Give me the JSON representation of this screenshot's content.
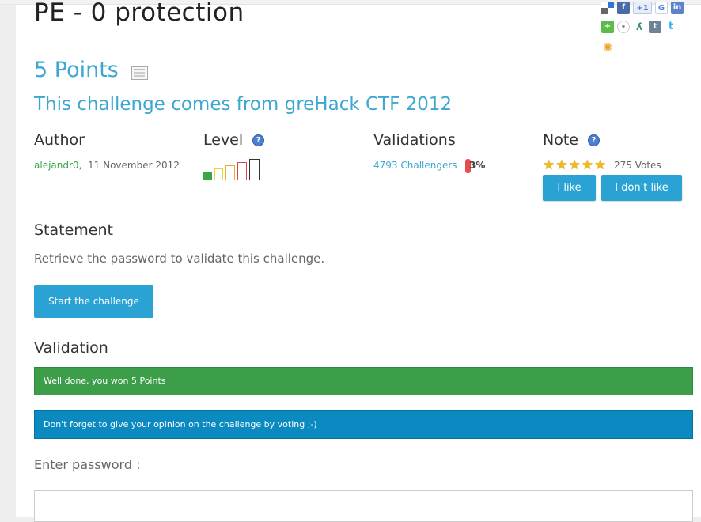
{
  "challenge": {
    "title": "PE - 0 protection",
    "points": "5 Points",
    "origin": "This challenge comes from greHack CTF 2012"
  },
  "share_icons": [
    {
      "icon": "delicious-icon"
    },
    {
      "icon": "facebook-icon"
    },
    {
      "icon": "google-plus-icon"
    },
    {
      "icon": "google-icon"
    },
    {
      "icon": "linkedin-icon"
    },
    {
      "icon": "add-more-icon"
    },
    {
      "icon": "reddit-icon"
    },
    {
      "icon": "stumbleupon-icon"
    },
    {
      "icon": "tumblr-icon"
    },
    {
      "icon": "twitter-icon"
    },
    {
      "icon": "netvibes-icon"
    }
  ],
  "author": {
    "heading": "Author",
    "name": "alejandr0",
    "date": "11 November 2012"
  },
  "level": {
    "heading": "Level",
    "value": 1,
    "max": 5,
    "colors": [
      "#3aa54a",
      "#e7d44a",
      "#f0a83a",
      "#e04545",
      "#333333"
    ]
  },
  "validations": {
    "heading": "Validations",
    "challengers": "4793 Challengers",
    "percent": "3%"
  },
  "note": {
    "heading": "Note",
    "stars": 5,
    "votes": "275 Votes",
    "like_label": "I like",
    "dislike_label": "I don't like"
  },
  "statement": {
    "heading": "Statement",
    "text": "Retrieve the password to validate this challenge.",
    "start_label": "Start the challenge"
  },
  "validation": {
    "heading": "Validation",
    "success_msg": "Well done, you won 5 Points",
    "info_msg": "Don't forget to give your opinion on the challenge by voting ;-)",
    "password_label": "Enter password :",
    "password_value": ""
  }
}
